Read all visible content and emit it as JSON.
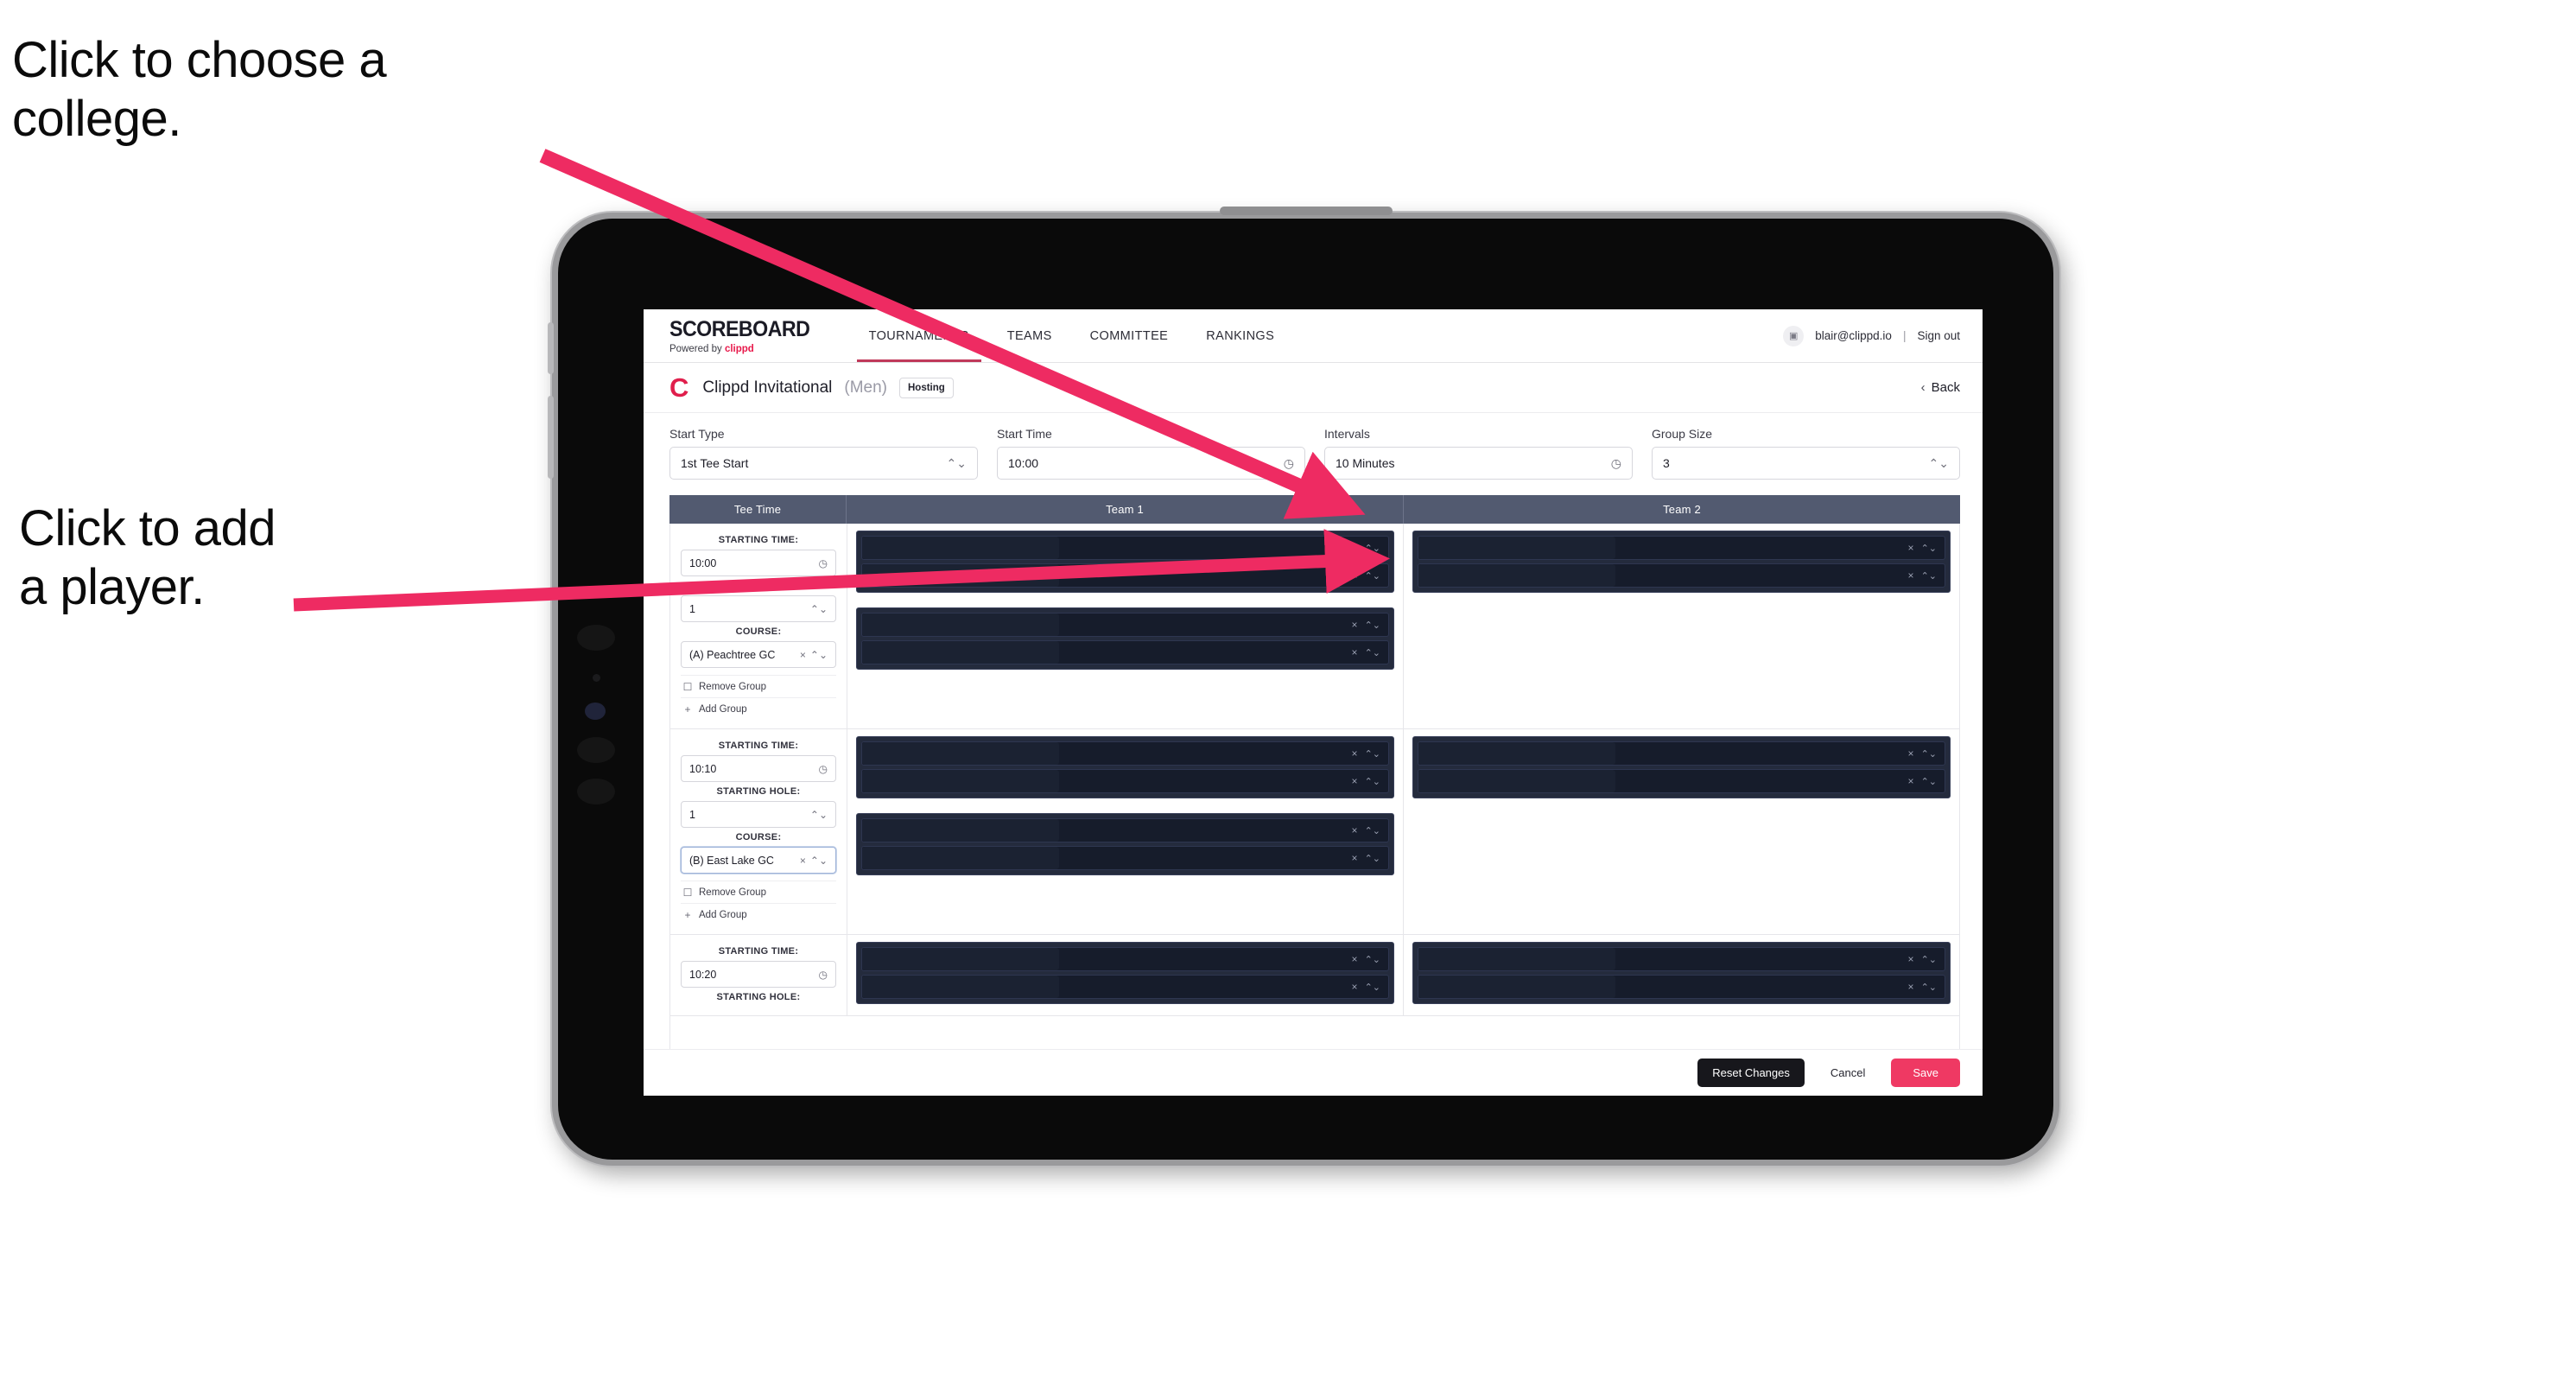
{
  "annotations": {
    "choose_college": "Click to choose a\ncollege.",
    "add_player": "Click to add\na player."
  },
  "brand": {
    "title": "SCOREBOARD",
    "powered_prefix": "Powered by ",
    "powered_name": "clippd"
  },
  "topnav": {
    "items": [
      {
        "label": "TOURNAMENTS",
        "active": true
      },
      {
        "label": "TEAMS",
        "active": false
      },
      {
        "label": "COMMITTEE",
        "active": false
      },
      {
        "label": "RANKINGS",
        "active": false
      }
    ],
    "avatar_glyph": "▣",
    "email": "blair@clippd.io",
    "separator": "|",
    "sign_out": "Sign out"
  },
  "title_bar": {
    "logo_letter": "C",
    "tournament_name": "Clippd Invitational",
    "gender": "(Men)",
    "badge": "Hosting",
    "back_label": "Back",
    "back_chevron": "‹"
  },
  "controls": [
    {
      "label": "Start Type",
      "value": "1st Tee Start",
      "icon": "stepper-icon",
      "icon_glyph": "⌃⌄"
    },
    {
      "label": "Start Time",
      "value": "10:00",
      "icon": "clock-icon",
      "icon_glyph": "◷"
    },
    {
      "label": "Intervals",
      "value": "10 Minutes",
      "icon": "clock-icon",
      "icon_glyph": "◷"
    },
    {
      "label": "Group Size",
      "value": "3",
      "icon": "stepper-icon",
      "icon_glyph": "⌃⌄"
    }
  ],
  "table": {
    "headers": [
      "Tee Time",
      "Team 1",
      "Team 2"
    ],
    "field_labels": {
      "starting_time": "STARTING TIME:",
      "starting_hole": "STARTING HOLE:",
      "course": "COURSE:"
    },
    "group_actions": {
      "remove": "Remove Group",
      "remove_icon_glyph": "☐",
      "add": "Add Group",
      "add_icon_glyph": "+"
    },
    "row_icons": {
      "clear_glyph": "×",
      "stepper_glyph": "⌃⌄"
    },
    "rows": [
      {
        "starting_time": "10:00",
        "starting_hole": "1",
        "course": "(A) Peachtree GC",
        "course_focused": false,
        "team1_groups": [
          2,
          2
        ],
        "team2_groups": [
          2
        ]
      },
      {
        "starting_time": "10:10",
        "starting_hole": "1",
        "course": "(B) East Lake GC",
        "course_focused": true,
        "team1_groups": [
          2,
          2
        ],
        "team2_groups": [
          2
        ]
      },
      {
        "starting_time": "10:20",
        "starting_hole": "",
        "course": "",
        "course_focused": false,
        "team1_groups": [
          2
        ],
        "team2_groups": [
          2
        ]
      }
    ]
  },
  "footer": {
    "reset": "Reset Changes",
    "cancel": "Cancel",
    "save": "Save"
  },
  "colors": {
    "accent_pink": "#ef3963",
    "brand_red": "#e01f4c",
    "table_header": "#525a70",
    "dark_group": "#242b3d",
    "annotation_arrow": "#ee2b62"
  }
}
